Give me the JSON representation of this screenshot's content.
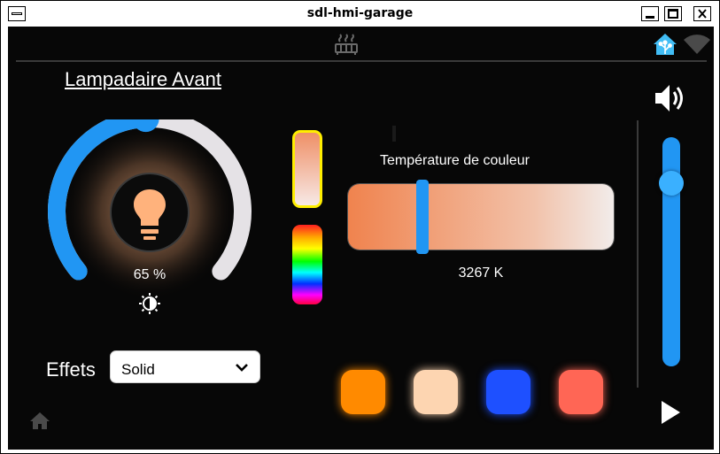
{
  "window": {
    "title": "sdl-hmi-garage"
  },
  "header": {
    "center_icon": "radiator-icon",
    "right_icons": [
      "home-assistant-icon",
      "wifi-icon"
    ]
  },
  "light": {
    "name": "Lampadaire Avant",
    "brightness_fraction": 0.65,
    "brightness_label": "65 %",
    "icon": "lightbulb-icon"
  },
  "color_temperature": {
    "label": "Température de couleur",
    "value_label": "3267 K",
    "slider_fraction": 0.28
  },
  "effects": {
    "label": "Effets",
    "selected": "Solid"
  },
  "color_modes": [
    "warm-white",
    "rgb"
  ],
  "presets": [
    {
      "name": "orange",
      "color": "#ff8a00"
    },
    {
      "name": "peach",
      "color": "#fdd5b1"
    },
    {
      "name": "blue",
      "color": "#1e50ff"
    },
    {
      "name": "salmon",
      "color": "#ff6655"
    }
  ],
  "volume": {
    "level_fraction": 0.8
  },
  "colors": {
    "accent": "#2196f3",
    "track": "#e5e2e6",
    "background": "#070707"
  }
}
